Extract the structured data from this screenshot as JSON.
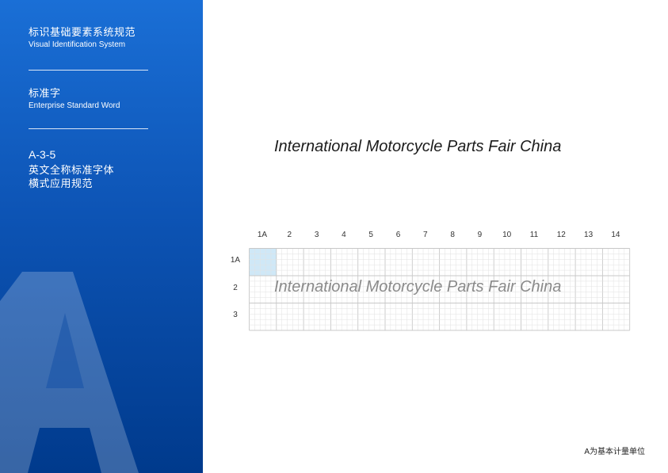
{
  "sidebar": {
    "title_cn": "标识基础要素系统规范",
    "title_en": "Visual Identification System",
    "section_cn": "标准字",
    "section_en": "Enterprise Standard Word",
    "code": "A-3-5",
    "desc_line1": "英文全称标准字体",
    "desc_line2": "横式应用规范",
    "watermark_letter": "A"
  },
  "main": {
    "title": "International Motorcycle Parts Fair China"
  },
  "grid": {
    "columns": [
      "1A",
      "2",
      "3",
      "4",
      "5",
      "6",
      "7",
      "8",
      "9",
      "10",
      "11",
      "12",
      "13",
      "14"
    ],
    "rows": [
      "1A",
      "2",
      "3"
    ],
    "sample_text": "International Motorcycle Parts Fair China",
    "unit_highlight_color": "#cfe8f7"
  },
  "footnote": "A为基本计量单位",
  "colors": {
    "sidebar_top": "#1a6fd6",
    "sidebar_bottom": "#003a8c",
    "grid_minor": "#e2e2e2",
    "grid_major": "#c8c8c8"
  }
}
